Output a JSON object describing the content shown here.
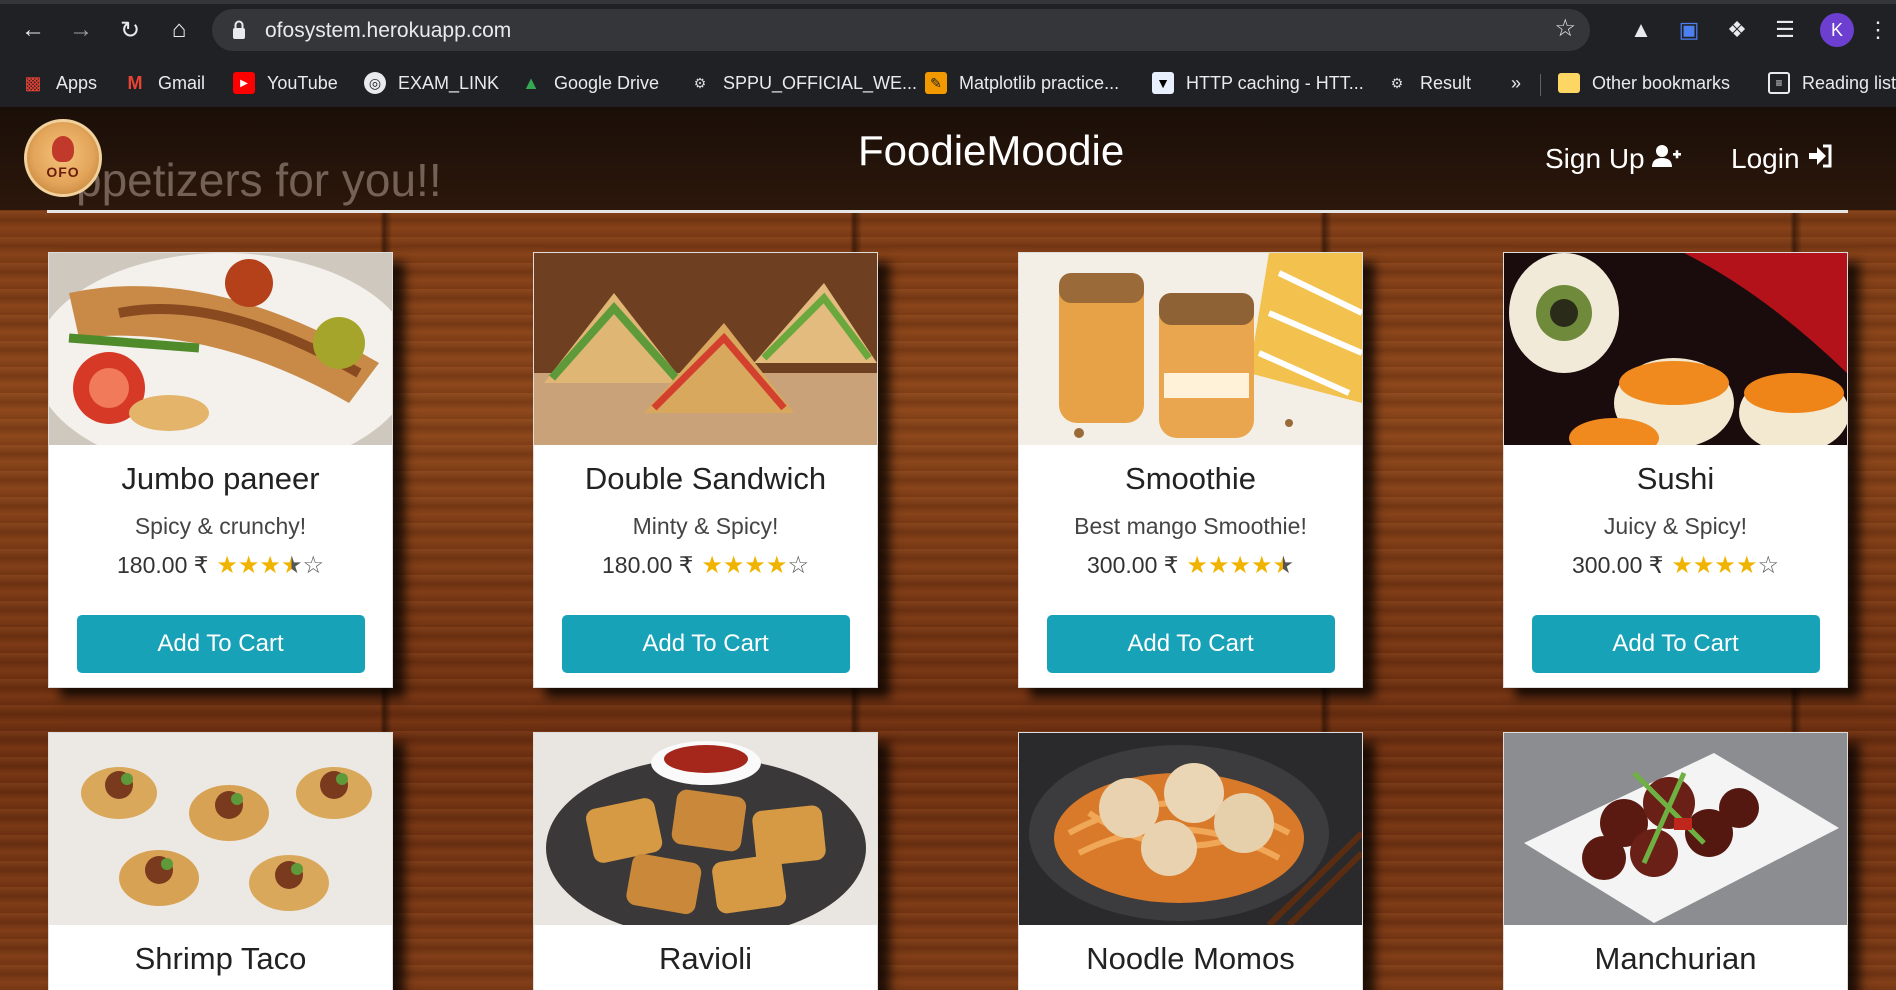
{
  "browser": {
    "url": "ofosystem.herokuapp.com",
    "avatar_letter": "K",
    "bookmarks": [
      {
        "label": "Apps",
        "icon": "apps-grid-icon"
      },
      {
        "label": "Gmail",
        "icon": "gmail-icon"
      },
      {
        "label": "YouTube",
        "icon": "youtube-icon"
      },
      {
        "label": "EXAM_LINK",
        "icon": "globe-icon"
      },
      {
        "label": "Google Drive",
        "icon": "google-drive-icon"
      },
      {
        "label": "SPPU_OFFICIAL_WE...",
        "icon": "sppu-icon"
      },
      {
        "label": "Matplotlib practice...",
        "icon": "notebook-icon"
      },
      {
        "label": "HTTP caching - HTT...",
        "icon": "mdn-icon"
      },
      {
        "label": "Result",
        "icon": "sppu-icon"
      },
      {
        "label": "»",
        "icon": "overflow-icon"
      },
      {
        "label": "Other bookmarks",
        "icon": "folder-icon"
      },
      {
        "label": "Reading list",
        "icon": "reading-list-icon"
      }
    ]
  },
  "site": {
    "logo_text": "OFO",
    "ghost_heading": "ppetizers for you!!",
    "brand": "FoodieMoodie",
    "signup": "Sign Up",
    "login": "Login"
  },
  "products": [
    {
      "name": "Jumbo paneer",
      "desc": "Spicy & crunchy!",
      "price": "180.00 ₹",
      "rating": 3.5,
      "button": "Add To Cart",
      "image": "paneer-wrap-photo"
    },
    {
      "name": "Double Sandwich",
      "desc": "Minty & Spicy!",
      "price": "180.00 ₹",
      "rating": 4,
      "button": "Add To Cart",
      "image": "sandwich-photo"
    },
    {
      "name": "Smoothie",
      "desc": "Best mango Smoothie!",
      "price": "300.00 ₹",
      "rating": 4.5,
      "button": "Add To Cart",
      "image": "smoothie-photo"
    },
    {
      "name": "Sushi",
      "desc": "Juicy & Spicy!",
      "price": "300.00 ₹",
      "rating": 4,
      "button": "Add To Cart",
      "image": "sushi-photo"
    },
    {
      "name": "Shrimp Taco",
      "image": "shrimp-taco-photo"
    },
    {
      "name": "Ravioli",
      "image": "ravioli-photo"
    },
    {
      "name": "Noodle Momos",
      "image": "noodle-momos-photo"
    },
    {
      "name": "Manchurian",
      "image": "manchurian-photo"
    }
  ],
  "colors": {
    "accent": "#17a2b8",
    "star": "#f0b400",
    "brand_text": "#ffffff"
  }
}
